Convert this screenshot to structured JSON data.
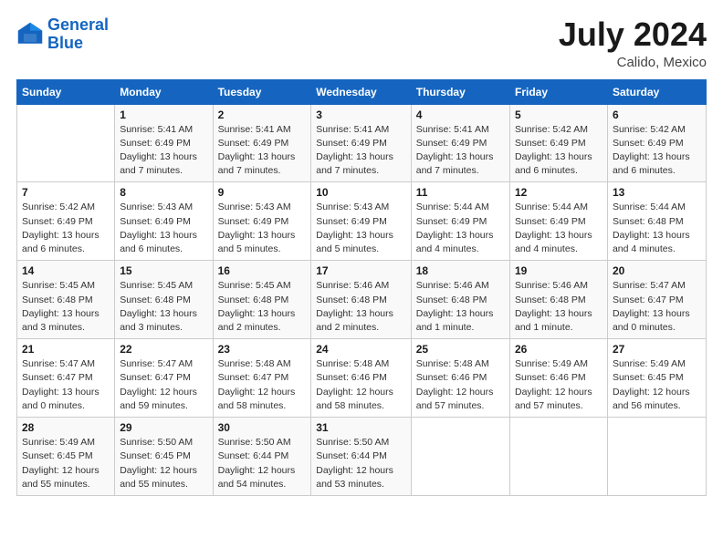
{
  "logo": {
    "line1": "General",
    "line2": "Blue"
  },
  "title": "July 2024",
  "subtitle": "Calido, Mexico",
  "days_header": [
    "Sunday",
    "Monday",
    "Tuesday",
    "Wednesday",
    "Thursday",
    "Friday",
    "Saturday"
  ],
  "weeks": [
    [
      {
        "num": "",
        "info": ""
      },
      {
        "num": "1",
        "info": "Sunrise: 5:41 AM\nSunset: 6:49 PM\nDaylight: 13 hours\nand 7 minutes."
      },
      {
        "num": "2",
        "info": "Sunrise: 5:41 AM\nSunset: 6:49 PM\nDaylight: 13 hours\nand 7 minutes."
      },
      {
        "num": "3",
        "info": "Sunrise: 5:41 AM\nSunset: 6:49 PM\nDaylight: 13 hours\nand 7 minutes."
      },
      {
        "num": "4",
        "info": "Sunrise: 5:41 AM\nSunset: 6:49 PM\nDaylight: 13 hours\nand 7 minutes."
      },
      {
        "num": "5",
        "info": "Sunrise: 5:42 AM\nSunset: 6:49 PM\nDaylight: 13 hours\nand 6 minutes."
      },
      {
        "num": "6",
        "info": "Sunrise: 5:42 AM\nSunset: 6:49 PM\nDaylight: 13 hours\nand 6 minutes."
      }
    ],
    [
      {
        "num": "7",
        "info": "Sunrise: 5:42 AM\nSunset: 6:49 PM\nDaylight: 13 hours\nand 6 minutes."
      },
      {
        "num": "8",
        "info": "Sunrise: 5:43 AM\nSunset: 6:49 PM\nDaylight: 13 hours\nand 6 minutes."
      },
      {
        "num": "9",
        "info": "Sunrise: 5:43 AM\nSunset: 6:49 PM\nDaylight: 13 hours\nand 5 minutes."
      },
      {
        "num": "10",
        "info": "Sunrise: 5:43 AM\nSunset: 6:49 PM\nDaylight: 13 hours\nand 5 minutes."
      },
      {
        "num": "11",
        "info": "Sunrise: 5:44 AM\nSunset: 6:49 PM\nDaylight: 13 hours\nand 4 minutes."
      },
      {
        "num": "12",
        "info": "Sunrise: 5:44 AM\nSunset: 6:49 PM\nDaylight: 13 hours\nand 4 minutes."
      },
      {
        "num": "13",
        "info": "Sunrise: 5:44 AM\nSunset: 6:48 PM\nDaylight: 13 hours\nand 4 minutes."
      }
    ],
    [
      {
        "num": "14",
        "info": "Sunrise: 5:45 AM\nSunset: 6:48 PM\nDaylight: 13 hours\nand 3 minutes."
      },
      {
        "num": "15",
        "info": "Sunrise: 5:45 AM\nSunset: 6:48 PM\nDaylight: 13 hours\nand 3 minutes."
      },
      {
        "num": "16",
        "info": "Sunrise: 5:45 AM\nSunset: 6:48 PM\nDaylight: 13 hours\nand 2 minutes."
      },
      {
        "num": "17",
        "info": "Sunrise: 5:46 AM\nSunset: 6:48 PM\nDaylight: 13 hours\nand 2 minutes."
      },
      {
        "num": "18",
        "info": "Sunrise: 5:46 AM\nSunset: 6:48 PM\nDaylight: 13 hours\nand 1 minute."
      },
      {
        "num": "19",
        "info": "Sunrise: 5:46 AM\nSunset: 6:48 PM\nDaylight: 13 hours\nand 1 minute."
      },
      {
        "num": "20",
        "info": "Sunrise: 5:47 AM\nSunset: 6:47 PM\nDaylight: 13 hours\nand 0 minutes."
      }
    ],
    [
      {
        "num": "21",
        "info": "Sunrise: 5:47 AM\nSunset: 6:47 PM\nDaylight: 13 hours\nand 0 minutes."
      },
      {
        "num": "22",
        "info": "Sunrise: 5:47 AM\nSunset: 6:47 PM\nDaylight: 12 hours\nand 59 minutes."
      },
      {
        "num": "23",
        "info": "Sunrise: 5:48 AM\nSunset: 6:47 PM\nDaylight: 12 hours\nand 58 minutes."
      },
      {
        "num": "24",
        "info": "Sunrise: 5:48 AM\nSunset: 6:46 PM\nDaylight: 12 hours\nand 58 minutes."
      },
      {
        "num": "25",
        "info": "Sunrise: 5:48 AM\nSunset: 6:46 PM\nDaylight: 12 hours\nand 57 minutes."
      },
      {
        "num": "26",
        "info": "Sunrise: 5:49 AM\nSunset: 6:46 PM\nDaylight: 12 hours\nand 57 minutes."
      },
      {
        "num": "27",
        "info": "Sunrise: 5:49 AM\nSunset: 6:45 PM\nDaylight: 12 hours\nand 56 minutes."
      }
    ],
    [
      {
        "num": "28",
        "info": "Sunrise: 5:49 AM\nSunset: 6:45 PM\nDaylight: 12 hours\nand 55 minutes."
      },
      {
        "num": "29",
        "info": "Sunrise: 5:50 AM\nSunset: 6:45 PM\nDaylight: 12 hours\nand 55 minutes."
      },
      {
        "num": "30",
        "info": "Sunrise: 5:50 AM\nSunset: 6:44 PM\nDaylight: 12 hours\nand 54 minutes."
      },
      {
        "num": "31",
        "info": "Sunrise: 5:50 AM\nSunset: 6:44 PM\nDaylight: 12 hours\nand 53 minutes."
      },
      {
        "num": "",
        "info": ""
      },
      {
        "num": "",
        "info": ""
      },
      {
        "num": "",
        "info": ""
      }
    ]
  ]
}
